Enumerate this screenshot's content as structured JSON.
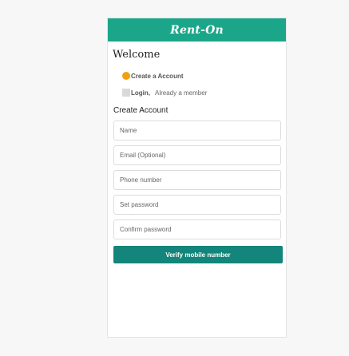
{
  "app": {
    "logo_text": "Rent-On",
    "welcome": "Welcome"
  },
  "colors": {
    "header": "#1ba68a",
    "button": "#13857a",
    "radio": "#f0a013"
  },
  "options": {
    "create_label": "Create a Account",
    "login_label": "Login,",
    "login_sub": "Already a member"
  },
  "form": {
    "title": "Create Account",
    "name_placeholder": "Name",
    "email_placeholder": "Email (Optional)",
    "phone_placeholder": "Phone number",
    "password_placeholder": "Set password",
    "confirm_placeholder": "Confirm password",
    "submit_label": "Verify mobile number"
  }
}
